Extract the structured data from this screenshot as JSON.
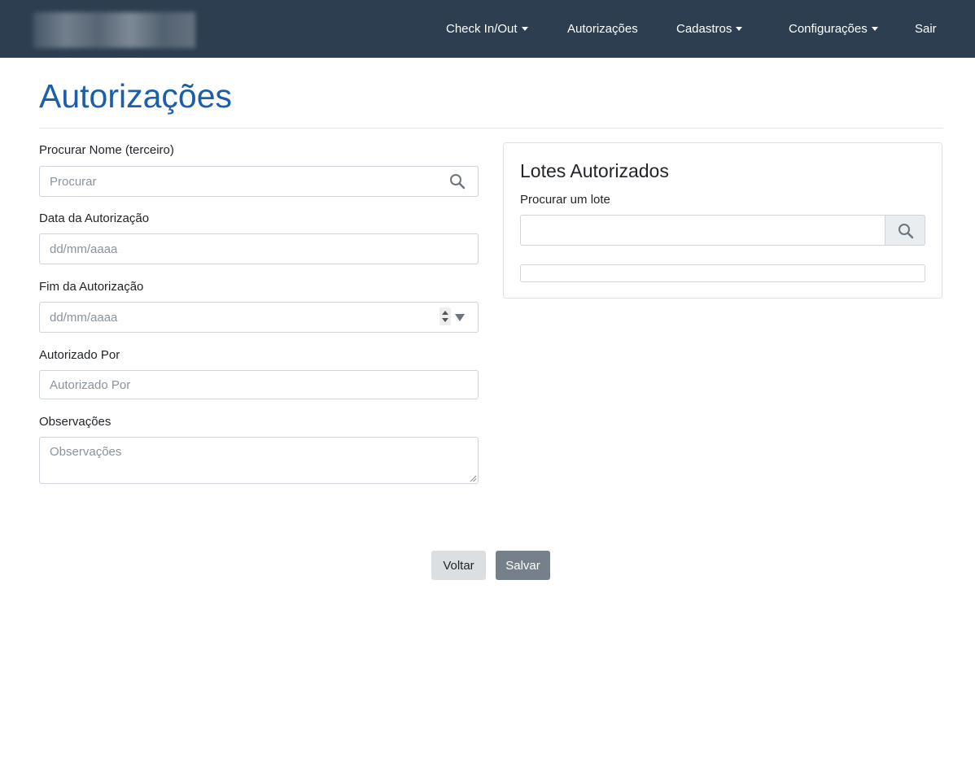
{
  "nav": {
    "items": [
      {
        "label": "Check In/Out",
        "dropdown": true
      },
      {
        "label": "Autorizações",
        "dropdown": false
      },
      {
        "label": "Cadastros",
        "dropdown": true
      },
      {
        "label": "Configurações",
        "dropdown": true
      },
      {
        "label": "Sair",
        "dropdown": false
      }
    ]
  },
  "page": {
    "title": "Autorizações"
  },
  "form": {
    "nome": {
      "label": "Procurar Nome (terceiro)",
      "placeholder": "Procurar",
      "icon": "search-icon"
    },
    "data": {
      "label": "Data da Autorização",
      "placeholder": "dd/mm/aaaa"
    },
    "fim": {
      "label": "Fim da Autorização",
      "placeholder": "dd/mm/aaaa"
    },
    "autorizado": {
      "label": "Autorizado Por",
      "placeholder": "Autorizado Por"
    },
    "obs": {
      "label": "Observações",
      "placeholder": "Observações"
    }
  },
  "lotes": {
    "title": "Lotes Autorizados",
    "search_label": "Procurar um lote",
    "search_value": "",
    "icon": "search-icon"
  },
  "actions": {
    "voltar": "Voltar",
    "salvar": "Salvar"
  },
  "colors": {
    "navbar": "#2c3e50",
    "title": "#1a5fa8",
    "salvar": "#76808b",
    "voltar": "#dcdfe2"
  }
}
